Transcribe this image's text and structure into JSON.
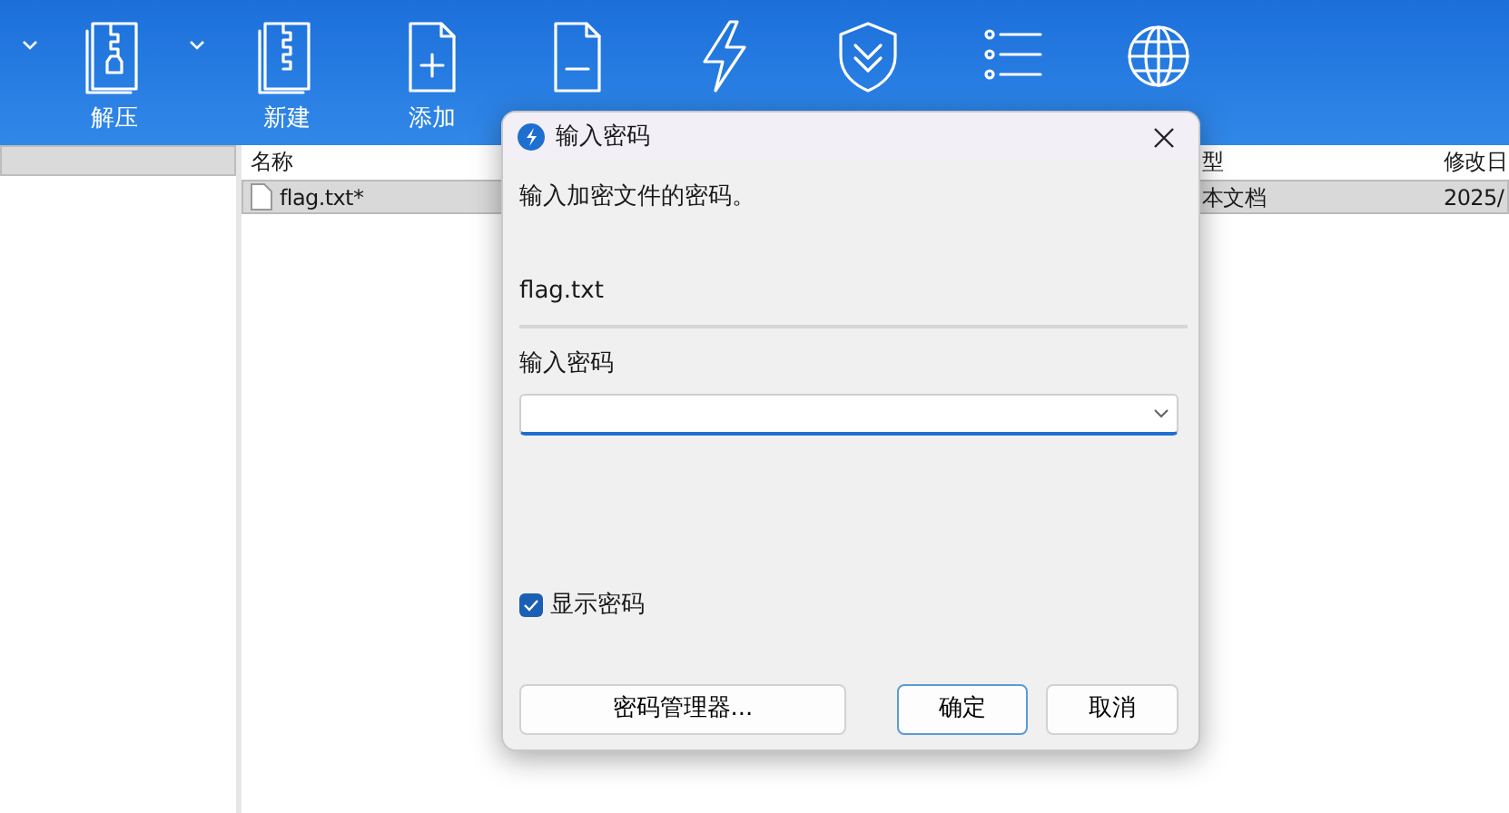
{
  "toolbar": [
    {
      "kind": "caret"
    },
    {
      "kind": "button",
      "label": "解压"
    },
    {
      "kind": "caret"
    },
    {
      "kind": "button",
      "label": "新建"
    },
    {
      "kind": "button",
      "label": "添加"
    },
    {
      "kind": "button"
    },
    {
      "kind": "button"
    },
    {
      "kind": "button"
    },
    {
      "kind": "button"
    },
    {
      "kind": "button"
    }
  ],
  "file_list": {
    "columns": [
      "名称",
      "型",
      "修改日"
    ],
    "rows": [
      {
        "cells": [
          "flag.txt*",
          "本文档",
          "2025/"
        ],
        "selected": true
      }
    ]
  },
  "dialog": {
    "title": "输入密码",
    "message": "输入加密文件的密码。",
    "filename": "flag.txt",
    "password_label": "输入密码",
    "show_password": {
      "label": "显示密码",
      "checked": true
    },
    "buttons": [
      {
        "label": "密码管理器...",
        "default": false
      },
      {
        "label": "确定",
        "default": true
      },
      {
        "label": "取消",
        "default": false
      }
    ]
  }
}
